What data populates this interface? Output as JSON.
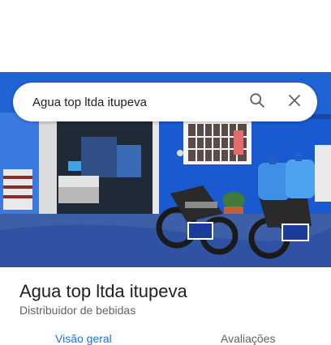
{
  "search": {
    "query": "Agua top ltda itupeva"
  },
  "icons": {
    "search": "search-icon",
    "close": "close-icon"
  },
  "place": {
    "name": "Agua top ltda itupeva",
    "category": "Distribuidor de bebidas",
    "photo_label": "storefront-photo"
  },
  "tabs": [
    {
      "label": "Visão geral"
    },
    {
      "label": "Avaliações"
    }
  ],
  "colors": {
    "accent": "#1a73e8",
    "text_primary": "#202124",
    "text_secondary": "#5f6368",
    "storefront_blue": "#1e63d6"
  }
}
